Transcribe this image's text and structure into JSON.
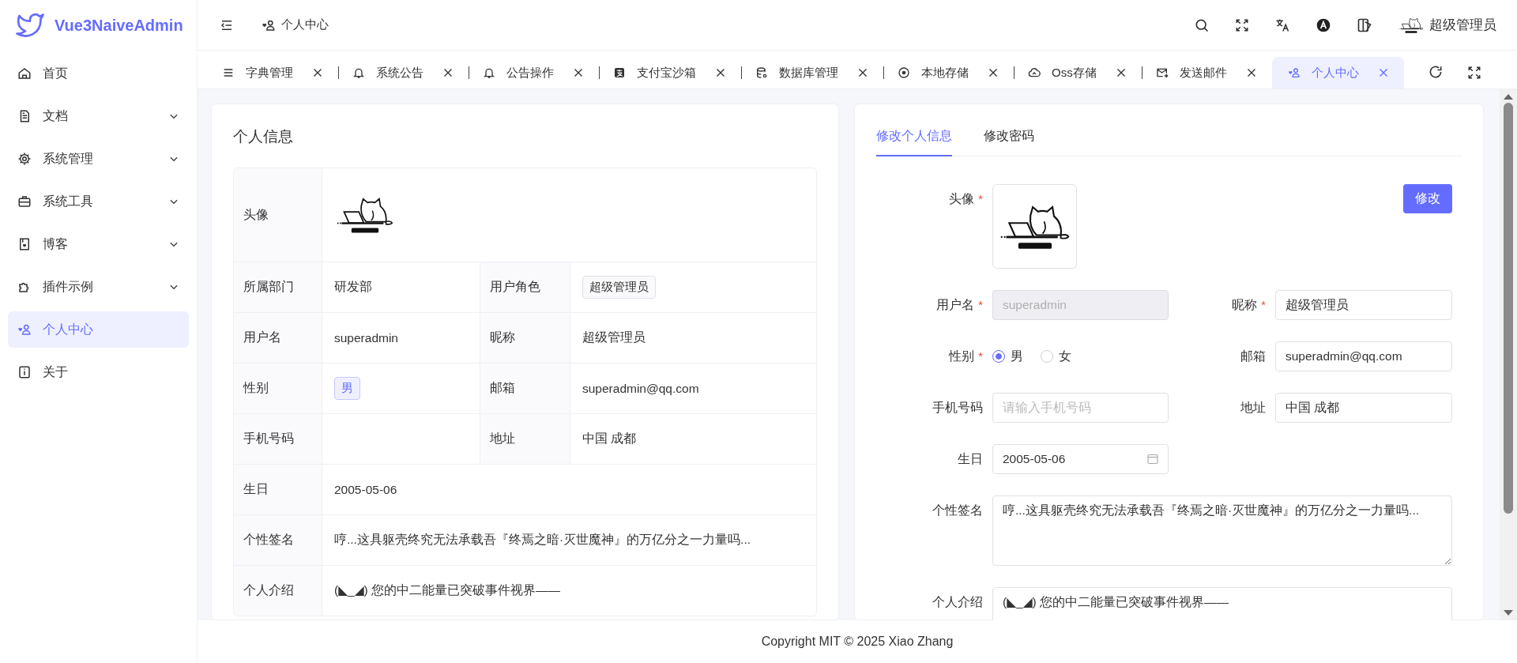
{
  "app": {
    "title": "Vue3NaiveAdmin"
  },
  "sidebar": {
    "items": [
      {
        "label": "首页",
        "kind": "link",
        "selected": false
      },
      {
        "label": "文档",
        "kind": "group",
        "expanded": false,
        "selected": false
      },
      {
        "label": "系统管理",
        "kind": "group",
        "expanded": false,
        "selected": false
      },
      {
        "label": "系统工具",
        "kind": "group",
        "expanded": false,
        "selected": false
      },
      {
        "label": "博客",
        "kind": "group",
        "expanded": false,
        "selected": false
      },
      {
        "label": "插件示例",
        "kind": "group",
        "expanded": false,
        "selected": false
      },
      {
        "label": "个人中心",
        "kind": "link",
        "selected": true
      },
      {
        "label": "关于",
        "kind": "link",
        "selected": false
      }
    ]
  },
  "header": {
    "breadcrumb": "个人中心",
    "user_name": "超级管理员"
  },
  "tabs": [
    {
      "label": "字典管理",
      "selected": false
    },
    {
      "label": "系统公告",
      "selected": false
    },
    {
      "label": "公告操作",
      "selected": false
    },
    {
      "label": "支付宝沙箱",
      "selected": false
    },
    {
      "label": "数据库管理",
      "selected": false
    },
    {
      "label": "本地存储",
      "selected": false
    },
    {
      "label": "Oss存储",
      "selected": false
    },
    {
      "label": "发送邮件",
      "selected": false
    },
    {
      "label": "个人中心",
      "selected": true
    }
  ],
  "info_card": {
    "title": "个人信息",
    "rows": [
      {
        "fields": [
          {
            "label": "头像",
            "kind": "avatar"
          }
        ]
      },
      {
        "fields": [
          {
            "label": "所属部门",
            "kind": "text",
            "value": "研发部"
          },
          {
            "label": "用户角色",
            "kind": "tag",
            "value": "超级管理员"
          }
        ]
      },
      {
        "fields": [
          {
            "label": "用户名",
            "kind": "text",
            "value": "superadmin"
          },
          {
            "label": "昵称",
            "kind": "text",
            "value": "超级管理员"
          }
        ]
      },
      {
        "fields": [
          {
            "label": "性别",
            "kind": "accent-tag",
            "value": "男"
          },
          {
            "label": "邮箱",
            "kind": "text",
            "value": "superadmin@qq.com"
          }
        ]
      },
      {
        "fields": [
          {
            "label": "手机号码",
            "kind": "text"
          },
          {
            "label": "地址",
            "kind": "text",
            "value": "中国 成都"
          }
        ]
      },
      {
        "fields": [
          {
            "label": "生日",
            "kind": "text",
            "value": "2005-05-06"
          }
        ]
      },
      {
        "fields": [
          {
            "label": "个性签名",
            "kind": "text",
            "value": "哼...这具躯壳终究无法承载吾『终焉之暗·灭世魔神』的万亿分之一力量吗..."
          }
        ]
      },
      {
        "fields": [
          {
            "label": "个人介绍",
            "kind": "text",
            "value": "(◣_◢) 您的中二能量已突破事件视界——"
          }
        ]
      }
    ]
  },
  "form_card": {
    "tabs": [
      {
        "label": "修改个人信息",
        "selected": true
      },
      {
        "label": "修改密码",
        "selected": false
      }
    ],
    "required_mark": "*",
    "avatar": {
      "label": "头像",
      "required": true,
      "button": "修改"
    },
    "rows": [
      {
        "fields": [
          {
            "label": "用户名",
            "required": true,
            "kind": "input",
            "value": "superadmin",
            "disabled": true
          },
          {
            "label": "昵称",
            "required": true,
            "kind": "input",
            "value": "超级管理员",
            "disabled": false
          }
        ]
      },
      {
        "fields": [
          {
            "label": "性别",
            "required": true,
            "kind": "radio",
            "options": [
              {
                "label": "男",
                "selected": true
              },
              {
                "label": "女",
                "selected": false
              }
            ]
          },
          {
            "label": "邮箱",
            "required": false,
            "kind": "input",
            "value": "superadmin@qq.com",
            "disabled": false
          }
        ]
      },
      {
        "fields": [
          {
            "label": "手机号码",
            "required": false,
            "kind": "input",
            "placeholder": "请输入手机号码",
            "disabled": false
          },
          {
            "label": "地址",
            "required": false,
            "kind": "input",
            "value": "中国 成都",
            "disabled": false
          }
        ]
      },
      {
        "fields": [
          {
            "label": "生日",
            "required": false,
            "kind": "date",
            "value": "2005-05-06"
          }
        ]
      },
      {
        "fields": [
          {
            "label": "个性签名",
            "required": false,
            "kind": "textarea",
            "value": "哼...这具躯壳终究无法承载吾『终焉之暗·灭世魔神』的万亿分之一力量吗..."
          }
        ]
      },
      {
        "fields": [
          {
            "label": "个人介绍",
            "required": false,
            "kind": "textarea",
            "value": "(◣_◢) 您的中二能量已突破事件视界——"
          }
        ]
      }
    ]
  },
  "footer": {
    "text": "Copyright MIT © 2025 Xiao Zhang"
  }
}
